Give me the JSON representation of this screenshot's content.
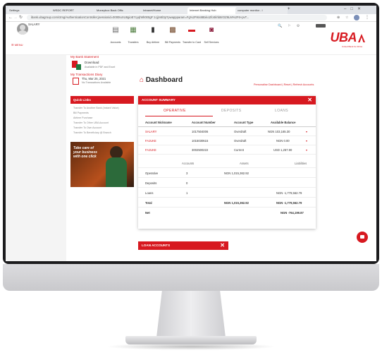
{
  "browser": {
    "tabs": [
      "Settings",
      "WSDC REPORT",
      "Moneybox Back Offic",
      "Intranet/Home",
      "Internet Banking Hub",
      "computer monitor - i"
    ],
    "url": "ibank.ubagroup.com/ctmg/AuthenticationController;jsessionid=0000IuXU8gioE7cyqh9h000gF:1cjjm5l3p?pwappparam=Fg%2FWx88txko2foSkhb8rOZ9LM%2F6+pvT..."
  },
  "header": {
    "user_name": "SALARY",
    "menu_label": "MENU",
    "toolbar": [
      {
        "label": "Accounts",
        "icon": "accounts-icon"
      },
      {
        "label": "Transfers",
        "icon": "transfers-icon"
      },
      {
        "label": "Buy Airtime",
        "icon": "airtime-icon"
      },
      {
        "label": "Bill Payments",
        "icon": "bill-icon"
      },
      {
        "label": "Transfer to Card",
        "icon": "card-icon"
      },
      {
        "label": "Self Services",
        "icon": "self-service-icon"
      }
    ],
    "brand": "UBA",
    "tagline": "United Bank for Africa"
  },
  "left_panel": {
    "statement_title": "My Bank Statement",
    "download_label": "Download",
    "download_sub": "Available in PDF and Excel",
    "diary_title": "My Transactions Diary",
    "diary_date": "Thu, Mar 25, 2021",
    "diary_sub": "No Transactions Available",
    "quick_links_title": "Quick Links",
    "quick_links": [
      "Transfer To Another Bank (Instant Value)",
      "Bill Payments",
      "Airtime Purchase",
      "Transfer To Other UBA Account",
      "Transfer To Own Account",
      "Transfer To Beneficiary @ Branch"
    ],
    "promo_text": "Take care of your business with one click"
  },
  "dashboard": {
    "title": "Dashboard",
    "links": [
      "Personalise Dashboard",
      "Reset",
      "Refresh Accounts"
    ],
    "summary_title": "ACCOUNT SUMMARY",
    "tabs": [
      "OPERATIVE",
      "DEPOSITS",
      "LOANS"
    ],
    "columns": [
      "Account Nickname",
      "Account Number",
      "Account Type",
      "Available Balance"
    ],
    "accounts": [
      {
        "nickname": "SALARY",
        "number": "1017504006",
        "type": "Overdraft",
        "balance": "NGN 103,165.30"
      },
      {
        "nickname": "FAJUKE",
        "number": "1015030615",
        "type": "Overdraft",
        "balance": "NGN 0.00"
      },
      {
        "nickname": "FAJUKE",
        "number": "3002500222",
        "type": "Current",
        "balance": "USD 1,257.90"
      }
    ],
    "totals_columns": [
      "Accounts",
      "Assets",
      "Liabilities"
    ],
    "totals": [
      {
        "label": "Operative",
        "accounts": "3",
        "assets": "NGN 1,015,362.92",
        "liabilities": ""
      },
      {
        "label": "Deposits",
        "accounts": "0",
        "assets": "",
        "liabilities": ""
      },
      {
        "label": "Loans",
        "accounts": "1",
        "assets": "",
        "liabilities": "NGN -1,779,562.79"
      },
      {
        "label": "Total",
        "accounts": "",
        "assets": "NGN 1,015,362.92",
        "liabilities": "NGN -1,779,562.79"
      },
      {
        "label": "Net",
        "accounts": "",
        "assets": "",
        "liabilities": "NGN -764,199.87"
      }
    ],
    "loan_title": "LOAN ACCOUNTS"
  },
  "colors": {
    "brand_red": "#d71920",
    "bezel": "#1c1c1e"
  }
}
